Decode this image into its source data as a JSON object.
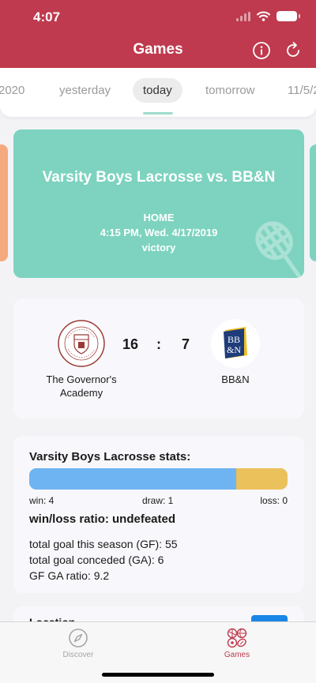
{
  "status_bar": {
    "time": "4:07"
  },
  "header": {
    "title": "Games"
  },
  "date_tabs": [
    "2020",
    "yesterday",
    "today",
    "tomorrow",
    "11/5/2"
  ],
  "game": {
    "title": "Varsity Boys Lacrosse vs. BB&N",
    "location_type": "HOME",
    "datetime": "4:15 PM, Wed. 4/17/2019",
    "result": "victory"
  },
  "score": {
    "home_team": "The Governor's Academy",
    "away_team": "BB&N",
    "home_score": "16",
    "separator": ":",
    "away_score": "7",
    "home_logo_text": "THE GOVERNOR'S ACADEMY",
    "away_logo_text": "BB&N"
  },
  "stats": {
    "title": "Varsity Boys Lacrosse stats:",
    "win_label": "win: 4",
    "draw_label": "draw: 1",
    "loss_label": "loss: 0",
    "win_fraction": 0.8,
    "ratio": "win/loss ratio: undefeated",
    "gf": "total goal this season (GF): 55",
    "ga": "total goal conceded (GA): 6",
    "gf_ga": "GF GA ratio: 9.2"
  },
  "location": {
    "title": "Location",
    "button": ""
  },
  "tab_bar": {
    "discover": "Discover",
    "games": "Games"
  },
  "colors": {
    "header": "#bf3a4e",
    "card": "#7dd3bf",
    "win": "#6fb4f2",
    "draw": "#ebc15c",
    "accent": "#1a86e6"
  }
}
